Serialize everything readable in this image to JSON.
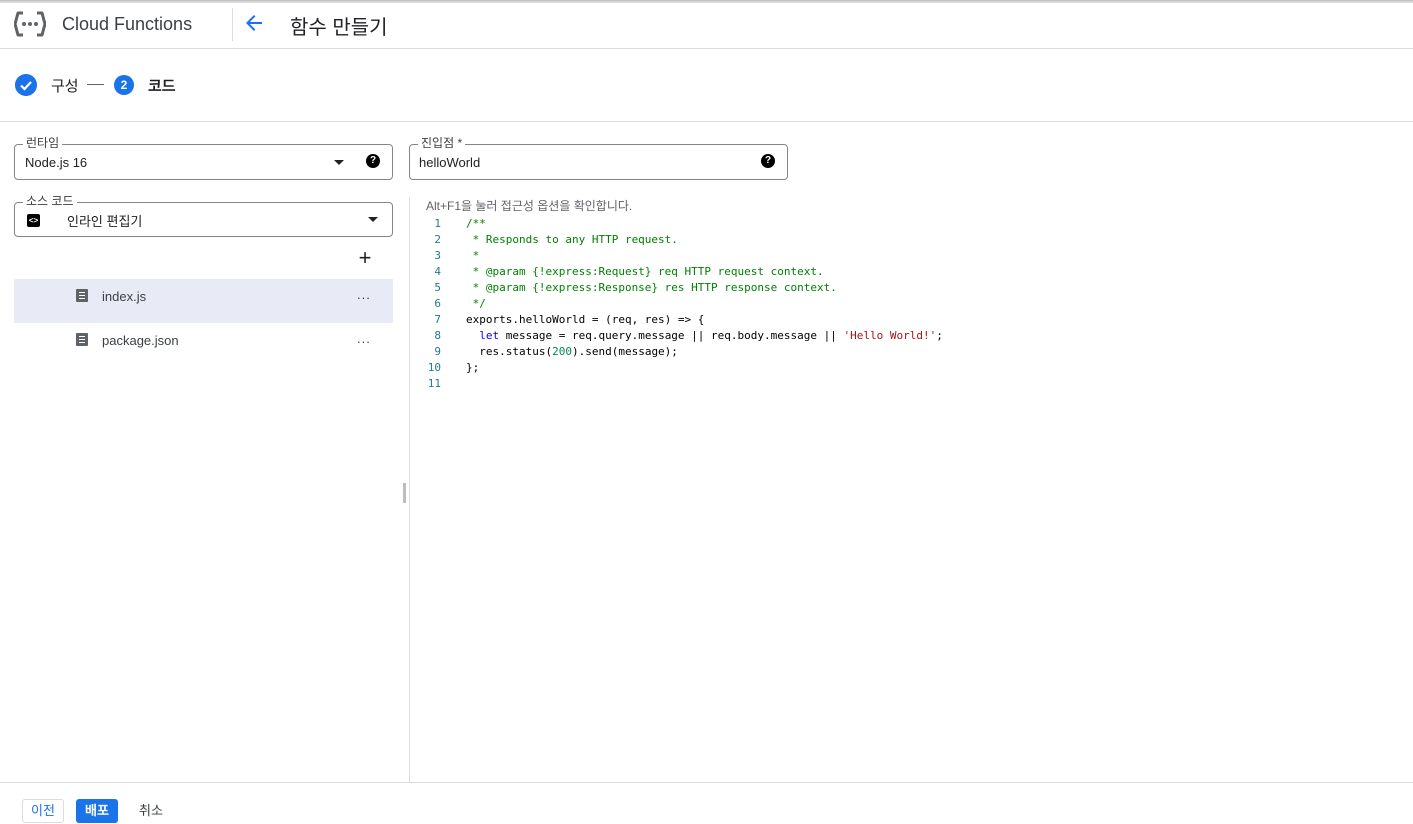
{
  "header": {
    "product_name": "Cloud Functions",
    "page_title": "함수 만들기"
  },
  "stepper": {
    "step1_label": "구성",
    "step2_number": "2",
    "step2_label": "코드"
  },
  "runtime": {
    "label": "런타임",
    "value": "Node.js 16"
  },
  "entry_point": {
    "label": "진입점 *",
    "value": "helloWorld"
  },
  "source_code": {
    "label": "소스 코드",
    "value": "인라인 편집기",
    "icon": "code-icon"
  },
  "files": {
    "add_icon": "+",
    "items": [
      {
        "name": "index.js",
        "more": "...",
        "selected": true
      },
      {
        "name": "package.json",
        "more": "...",
        "selected": false
      }
    ]
  },
  "editor": {
    "a11y_hint": "Alt+F1을 눌러 접근성 옵션을 확인합니다.",
    "lines": [
      {
        "n": "1",
        "tokens": [
          [
            "c-comment",
            "/**"
          ]
        ]
      },
      {
        "n": "2",
        "tokens": [
          [
            "c-comment",
            " * Responds to any HTTP request."
          ]
        ]
      },
      {
        "n": "3",
        "tokens": [
          [
            "c-comment",
            " *"
          ]
        ]
      },
      {
        "n": "4",
        "tokens": [
          [
            "c-comment",
            " * @param {!express:Request} req HTTP request context."
          ]
        ]
      },
      {
        "n": "5",
        "tokens": [
          [
            "c-comment",
            " * @param {!express:Response} res HTTP response context."
          ]
        ]
      },
      {
        "n": "6",
        "tokens": [
          [
            "c-comment",
            " */"
          ]
        ]
      },
      {
        "n": "7",
        "tokens": [
          [
            "c-plain",
            "exports.helloWorld = (req, res) => {"
          ]
        ]
      },
      {
        "n": "8",
        "tokens": [
          [
            "c-plain",
            "  "
          ],
          [
            "c-keyword",
            "let"
          ],
          [
            "c-plain",
            " message = req.query.message || req.body.message || "
          ],
          [
            "c-string",
            "'Hello World!'"
          ],
          [
            "c-plain",
            ";"
          ]
        ]
      },
      {
        "n": "9",
        "tokens": [
          [
            "c-plain",
            "  res.status("
          ],
          [
            "c-number",
            "200"
          ],
          [
            "c-plain",
            ").send(message);"
          ]
        ]
      },
      {
        "n": "10",
        "tokens": [
          [
            "c-plain",
            "};"
          ]
        ]
      },
      {
        "n": "11",
        "tokens": [
          [
            "c-plain",
            ""
          ]
        ]
      }
    ]
  },
  "footer": {
    "prev_label": "이전",
    "deploy_label": "배포",
    "cancel_label": "취소"
  },
  "colors": {
    "accent": "#1a73e8",
    "selected_row": "#e8eaf6"
  }
}
